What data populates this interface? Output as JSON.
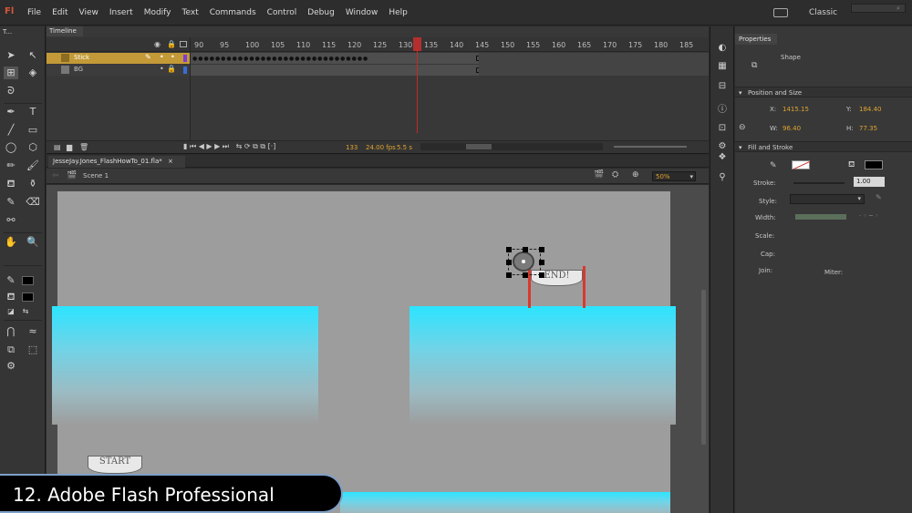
{
  "app": {
    "logo": "Fl",
    "menu": [
      "File",
      "Edit",
      "View",
      "Insert",
      "Modify",
      "Text",
      "Commands",
      "Control",
      "Debug",
      "Window",
      "Help"
    ],
    "workspace": "Classic"
  },
  "tools": {
    "panel_title": "T..."
  },
  "timeline": {
    "tab_label": "Timeline",
    "frame_numbers": [
      "90",
      "95",
      "100",
      "105",
      "110",
      "115",
      "120",
      "125",
      "130",
      "135",
      "140",
      "145",
      "150",
      "155",
      "160",
      "165",
      "170",
      "175",
      "180",
      "185"
    ],
    "layers": [
      {
        "name": "Stick",
        "selected": true
      },
      {
        "name": "BG",
        "selected": false
      }
    ],
    "footer": {
      "frame": "133",
      "fps": "24.00 fps",
      "time": "5.5 s"
    }
  },
  "document": {
    "tab_label": "JesseJay.Jones_FlashHowTo_01.fla*",
    "scene_label": "Scene 1",
    "zoom": "50%",
    "banner_end": "END!",
    "banner_start": "START"
  },
  "properties": {
    "tab_label": "Properties",
    "object_type": "Shape",
    "position_section": "Position and Size",
    "x_label": "X:",
    "x_value": "1415.15",
    "y_label": "Y:",
    "y_value": "184.40",
    "w_label": "W:",
    "w_value": "96.40",
    "h_label": "H:",
    "h_value": "77.35",
    "fill_section": "Fill and Stroke",
    "stroke_label": "Stroke:",
    "stroke_value": "1.00",
    "style_label": "Style:",
    "width_label": "Width:",
    "scale_label": "Scale:",
    "cap_label": "Cap:",
    "join_label": "Join:",
    "miter_label": "Miter:"
  },
  "caption": "12. Adobe Flash Professional",
  "colors": {
    "accent": "#e0a430",
    "platform": "#2ce4ff",
    "stage": "#9d9d9d",
    "playhead": "#c62a2a"
  }
}
